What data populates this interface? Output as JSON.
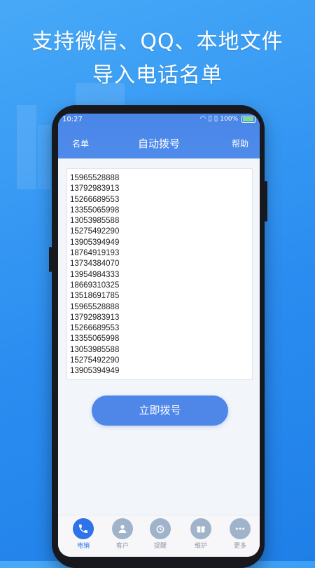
{
  "promo": {
    "line1": "支持微信、QQ、本地文件",
    "line2": "导入电话名单"
  },
  "status": {
    "time": "10:27",
    "battery": "100%"
  },
  "nav": {
    "left": "名单",
    "title": "自动拨号",
    "right": "帮助"
  },
  "numbers": [
    "15965528888",
    "13792983913",
    "15266689553",
    "13355065998",
    "13053985588",
    "15275492290",
    "13905394949",
    "18764919193",
    "13734384070",
    "13954984333",
    "18669310325",
    "13518691785",
    "15965528888",
    "13792983913",
    "15266689553",
    "13355065998",
    "13053985588",
    "15275492290",
    "13905394949"
  ],
  "dial_button": "立即拨号",
  "tabs": [
    {
      "label": "电销",
      "icon": "phone-icon"
    },
    {
      "label": "客户",
      "icon": "user-icon"
    },
    {
      "label": "提醒",
      "icon": "alarm-clock-icon"
    },
    {
      "label": "维护",
      "icon": "gift-icon"
    },
    {
      "label": "更多",
      "icon": "more-icon"
    }
  ],
  "colors": {
    "accent": "#4f87e9",
    "active_tab": "#2e73e8",
    "inactive_tab": "#9fb3cb"
  }
}
